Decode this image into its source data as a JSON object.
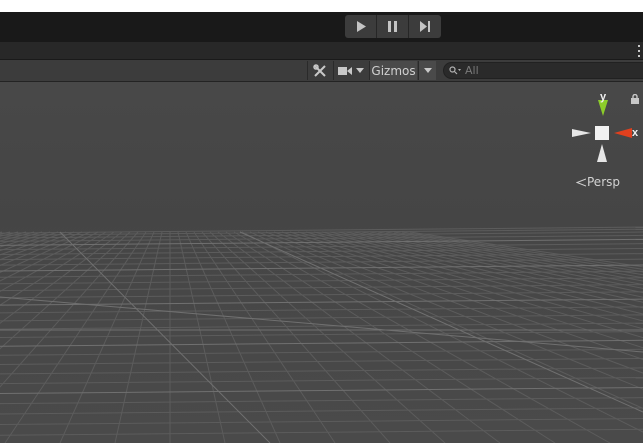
{
  "playbar": {
    "buttons": [
      {
        "name": "play",
        "icon": "play-icon"
      },
      {
        "name": "pause",
        "icon": "pause-icon"
      },
      {
        "name": "step",
        "icon": "step-icon"
      }
    ]
  },
  "toolbar": {
    "tools_icon": "tools-icon",
    "camera_icon": "camera-icon",
    "gizmos_label": "Gizmos",
    "search_placeholder": "All"
  },
  "scene": {
    "gizmo_axis_y": "y",
    "gizmo_axis_x": "x",
    "view_mode": "Persp",
    "colors": {
      "axis_y": "#8ccc2a",
      "axis_x": "#e0401e",
      "background": "#484848"
    }
  }
}
